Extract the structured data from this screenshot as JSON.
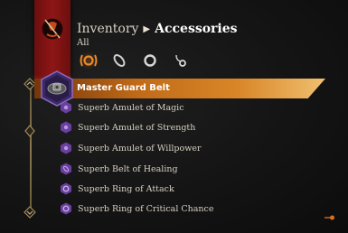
{
  "header": {
    "breadcrumb_root": "Inventory",
    "breadcrumb_current": "Accessories",
    "subcategory": "All"
  },
  "filters": [
    {
      "icon": "all-accessories-icon",
      "active": true
    },
    {
      "icon": "belt-icon",
      "active": false
    },
    {
      "icon": "ring-icon",
      "active": false
    },
    {
      "icon": "amulet-icon",
      "active": false
    }
  ],
  "items": [
    {
      "label": "Master Guard Belt",
      "icon": "belt-icon",
      "selected": true
    },
    {
      "label": "Superb Amulet of Magic",
      "icon": "amulet-icon",
      "selected": false
    },
    {
      "label": "Superb Amulet of Strength",
      "icon": "amulet-icon",
      "selected": false
    },
    {
      "label": "Superb Amulet of Willpower",
      "icon": "amulet-icon",
      "selected": false
    },
    {
      "label": "Superb Belt of Healing",
      "icon": "belt-icon",
      "selected": false
    },
    {
      "label": "Superb Ring of Attack",
      "icon": "ring-icon",
      "selected": false
    },
    {
      "label": "Superb Ring of Critical Chance",
      "icon": "ring-icon",
      "selected": false
    }
  ],
  "colors": {
    "accent": "#e88a2a",
    "banner": "#8f1616",
    "rarity": "#6a3fa0"
  }
}
